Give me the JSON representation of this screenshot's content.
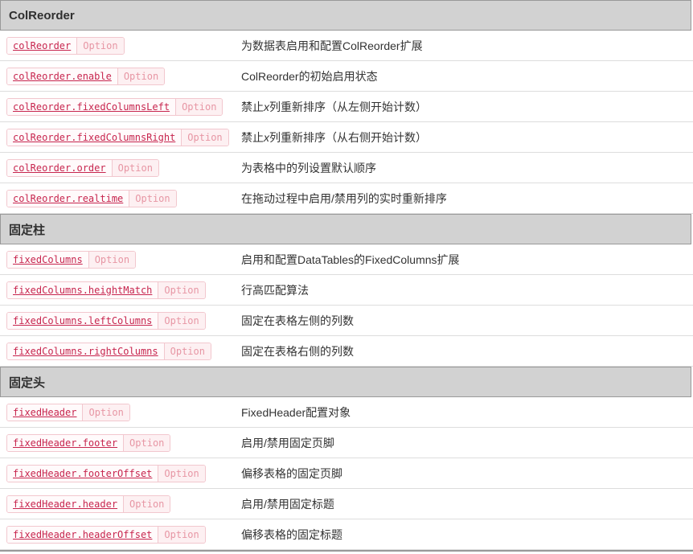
{
  "theme": {
    "link_color": "#c7254e",
    "link_bg": "#fffafb",
    "type_color": "#e796a4",
    "type_bg": "#fdf0f2",
    "badge_border": "#f2c7ce",
    "header_bg": "#d2d2d2",
    "header_border": "#999999",
    "divider": "#dddddd",
    "text_color": "#333333"
  },
  "badge_label": "Option",
  "sections": [
    {
      "title": "ColReorder",
      "rows": [
        {
          "code": "colReorder",
          "desc": [
            {
              "t": "为数据表启用和配置ColReorder扩展"
            }
          ]
        },
        {
          "code": "colReorder.enable",
          "desc": [
            {
              "t": "ColReorder的初始启用状态"
            }
          ]
        },
        {
          "code": "colReorder.fixedColumnsLeft",
          "desc": [
            {
              "t": "禁止"
            },
            {
              "t": "x",
              "i": true
            },
            {
              "t": "列重新排序（从左侧开始计数）"
            }
          ]
        },
        {
          "code": "colReorder.fixedColumnsRight",
          "desc": [
            {
              "t": "禁止"
            },
            {
              "t": "x",
              "i": true
            },
            {
              "t": "列重新排序（从右侧开始计数）"
            }
          ]
        },
        {
          "code": "colReorder.order",
          "desc": [
            {
              "t": "为表格中的列设置默认顺序"
            }
          ]
        },
        {
          "code": "colReorder.realtime",
          "desc": [
            {
              "t": "在拖动过程中启用/禁用列的实时重新排序"
            }
          ]
        }
      ]
    },
    {
      "title": "固定柱",
      "rows": [
        {
          "code": "fixedColumns",
          "desc": [
            {
              "t": "启用和配置DataTables的FixedColumns扩展"
            }
          ]
        },
        {
          "code": "fixedColumns.heightMatch",
          "desc": [
            {
              "t": "行高匹配算法"
            }
          ]
        },
        {
          "code": "fixedColumns.leftColumns",
          "desc": [
            {
              "t": "固定在表格左侧的列数"
            }
          ]
        },
        {
          "code": "fixedColumns.rightColumns",
          "desc": [
            {
              "t": "固定在表格右侧的列数"
            }
          ]
        }
      ]
    },
    {
      "title": "固定头",
      "rows": [
        {
          "code": "fixedHeader",
          "desc": [
            {
              "t": "FixedHeader配置对象"
            }
          ]
        },
        {
          "code": "fixedHeader.footer",
          "desc": [
            {
              "t": "启用/禁用固定页脚"
            }
          ]
        },
        {
          "code": "fixedHeader.footerOffset",
          "desc": [
            {
              "t": "偏移表格的固定页脚"
            }
          ]
        },
        {
          "code": "fixedHeader.header",
          "desc": [
            {
              "t": "启用/禁用固定标题"
            }
          ]
        },
        {
          "code": "fixedHeader.headerOffset",
          "desc": [
            {
              "t": "偏移表格的固定标题"
            }
          ]
        }
      ]
    }
  ]
}
